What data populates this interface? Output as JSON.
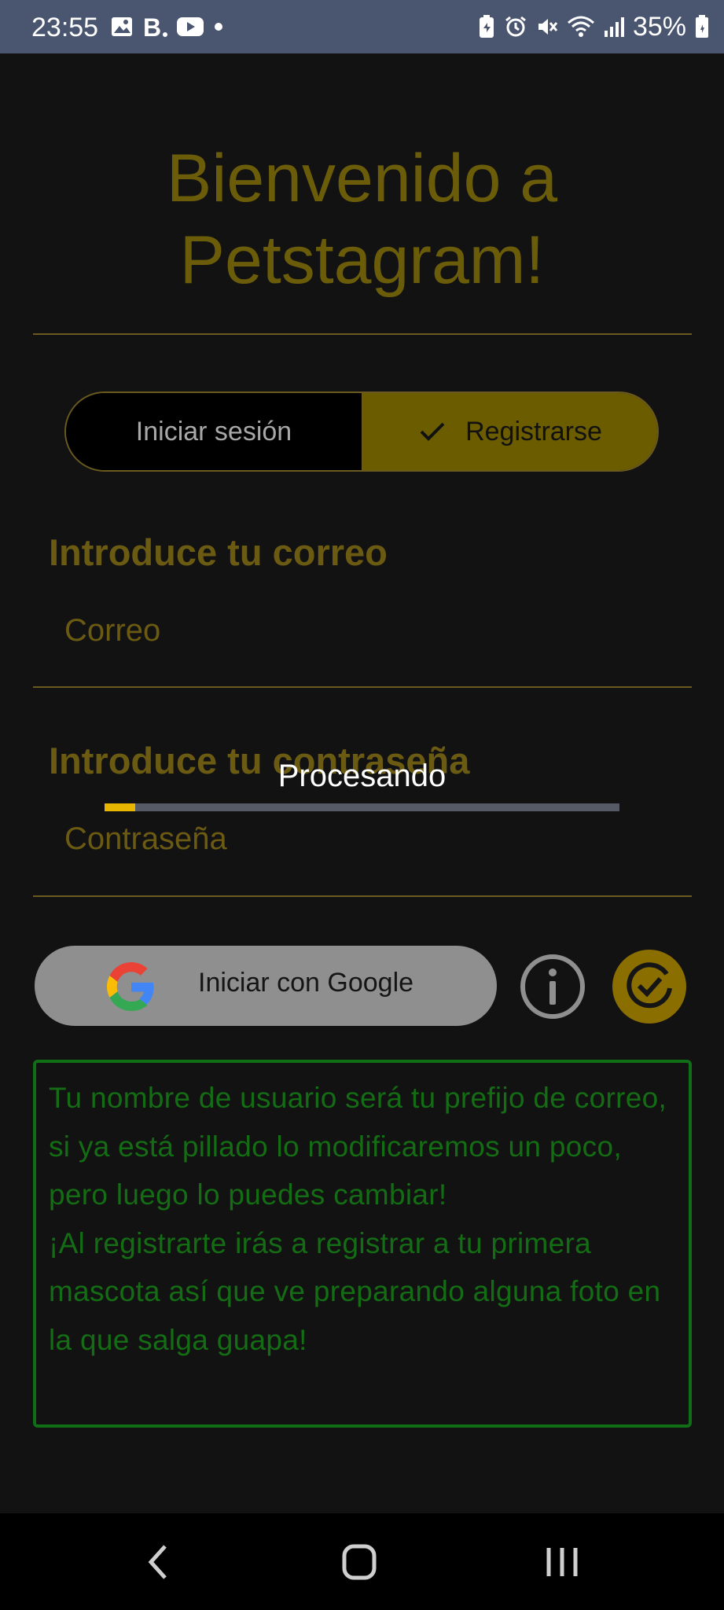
{
  "status_bar": {
    "time": "23:55",
    "battery": "35%",
    "left_icons": [
      "image-icon",
      "b-app-icon",
      "youtube-icon",
      "dot-icon"
    ],
    "right_icons": [
      "battery-saver-icon",
      "alarm-icon",
      "mute-icon",
      "wifi-icon",
      "signal-icon",
      "battery-icon"
    ]
  },
  "header": {
    "title_line1": "Bienvenido a",
    "title_line2": "Petstagram!"
  },
  "auth_toggle": {
    "login_label": "Iniciar sesión",
    "register_label": "Registrarse",
    "selected": "register"
  },
  "form": {
    "email_label": "Introduce tu correo",
    "email_placeholder": "Correo",
    "password_label": "Introduce tu contraseña",
    "password_placeholder": "Contraseña"
  },
  "progress": {
    "label": "Procesando",
    "value": 0.06
  },
  "actions": {
    "google_label": "Iniciar con Google"
  },
  "info": {
    "paragraph1": "Tu nombre de usuario será tu prefijo de correo, si ya está pillado lo modificaremos un poco, pero luego lo puedes cambiar!",
    "paragraph2": "¡Al registrarte irás a registrar a tu primera mascota así que ve preparando alguna foto en la que salga guapa!"
  },
  "colors": {
    "background": "#121212",
    "accent_gold": "#6b5c00",
    "progress_fill": "#e8b500",
    "info_green": "#146c14"
  }
}
